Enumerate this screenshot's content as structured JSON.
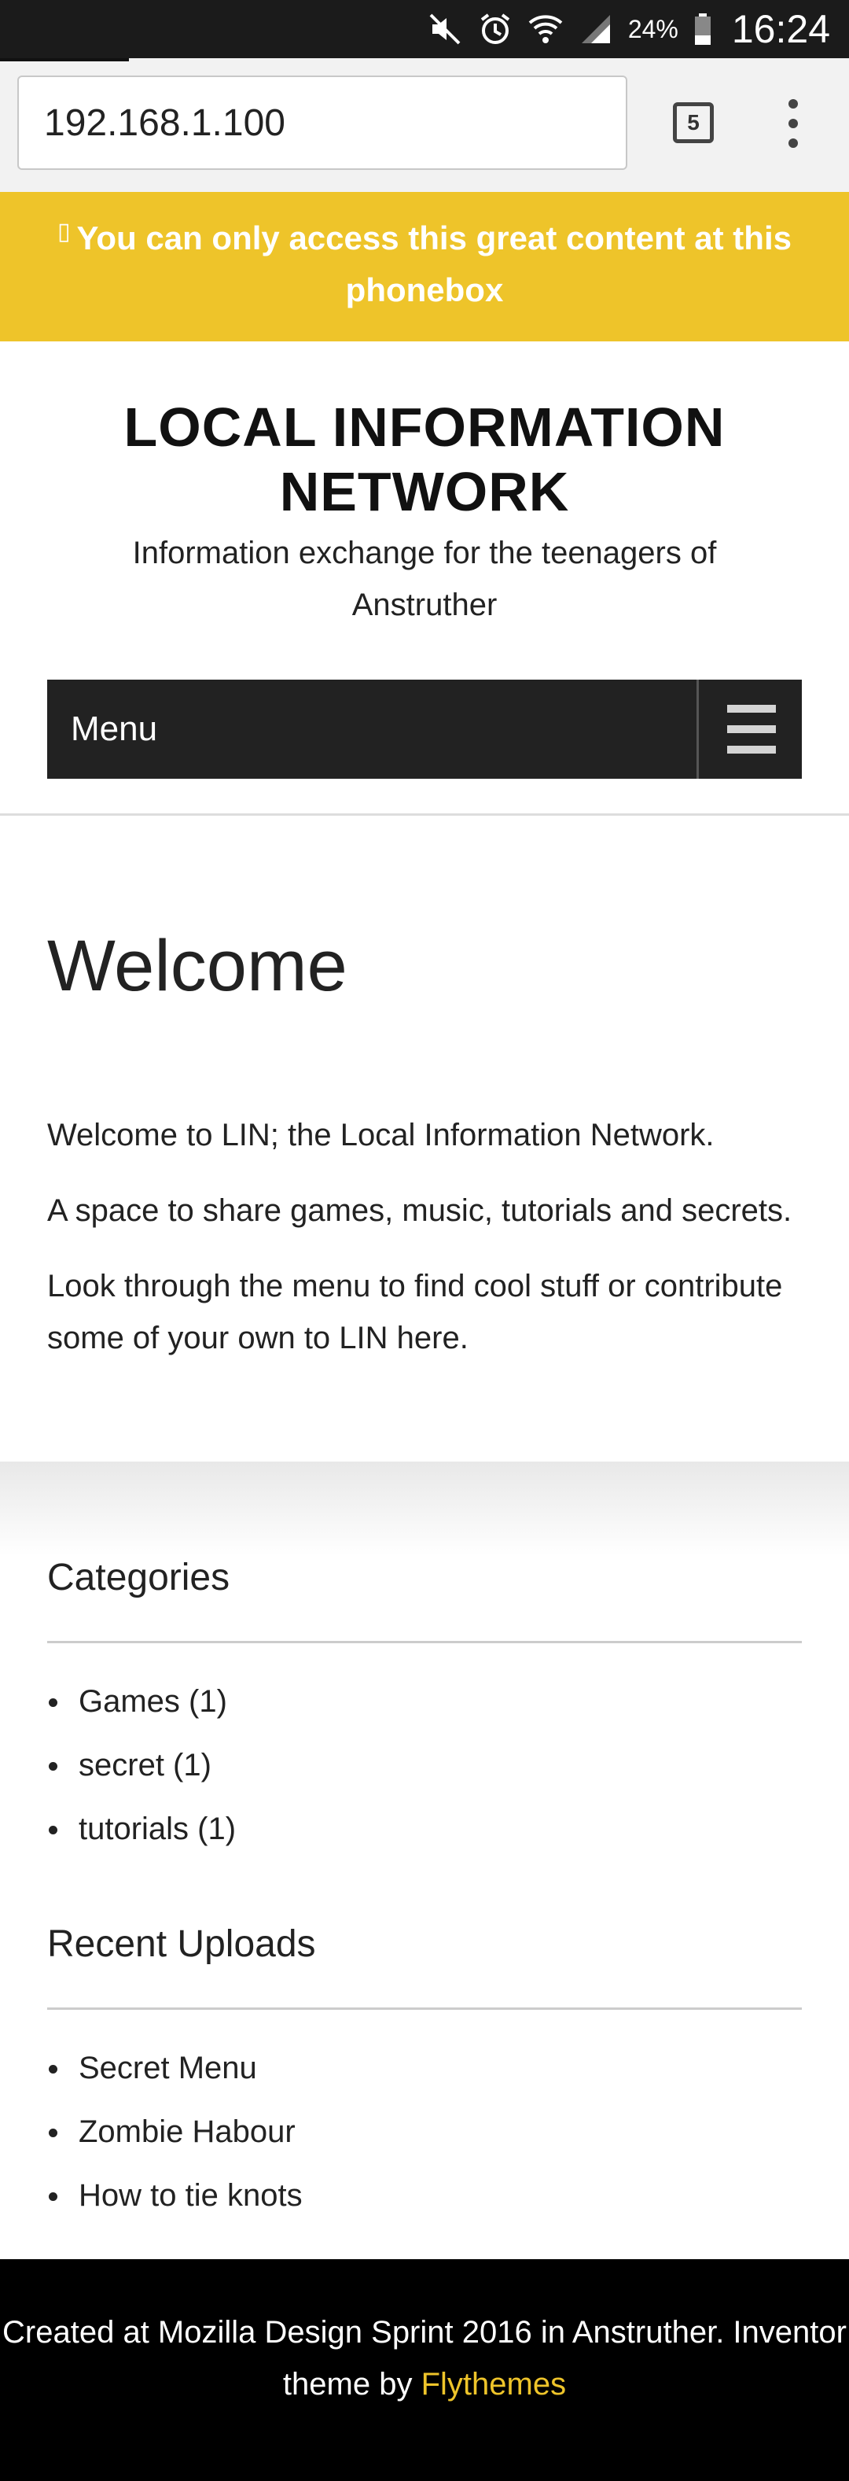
{
  "status_bar": {
    "battery_percent": "24%",
    "time": "16:24",
    "icons": [
      "mute-icon",
      "alarm-icon",
      "wifi-icon",
      "signal-icon",
      "battery-icon"
    ]
  },
  "browser": {
    "url": "192.168.1.100",
    "tab_count": "5"
  },
  "notice": {
    "glyph": "▯",
    "text": "You can only access this great content at this phonebox"
  },
  "header": {
    "title_line1": "LOCAL INFORMATION",
    "title_line2": "NETWORK",
    "description": "Information exchange for the teenagers of Anstruther",
    "menu_label": "Menu"
  },
  "main": {
    "title": "Welcome",
    "paragraphs": [
      "Welcome to LIN; the Local Information Network.",
      "A space to share games, music, tutorials and secrets.",
      "Look through the menu to find cool stuff or contribute some of your own to LIN here."
    ]
  },
  "categories": {
    "title": "Categories",
    "items": [
      "Games (1)",
      "secret (1)",
      "tutorials (1)"
    ]
  },
  "recent_uploads": {
    "title": "Recent Uploads",
    "items": [
      "Secret Menu",
      "Zombie Habour",
      "How to tie knots"
    ]
  },
  "footer": {
    "text": "Created at Mozilla Design Sprint 2016 in Anstruther. Inventor theme by",
    "link_text": "Flythemes"
  },
  "colors": {
    "accent_yellow": "#eec42a",
    "menu_bar": "#222222",
    "footer_bg": "#000000"
  }
}
